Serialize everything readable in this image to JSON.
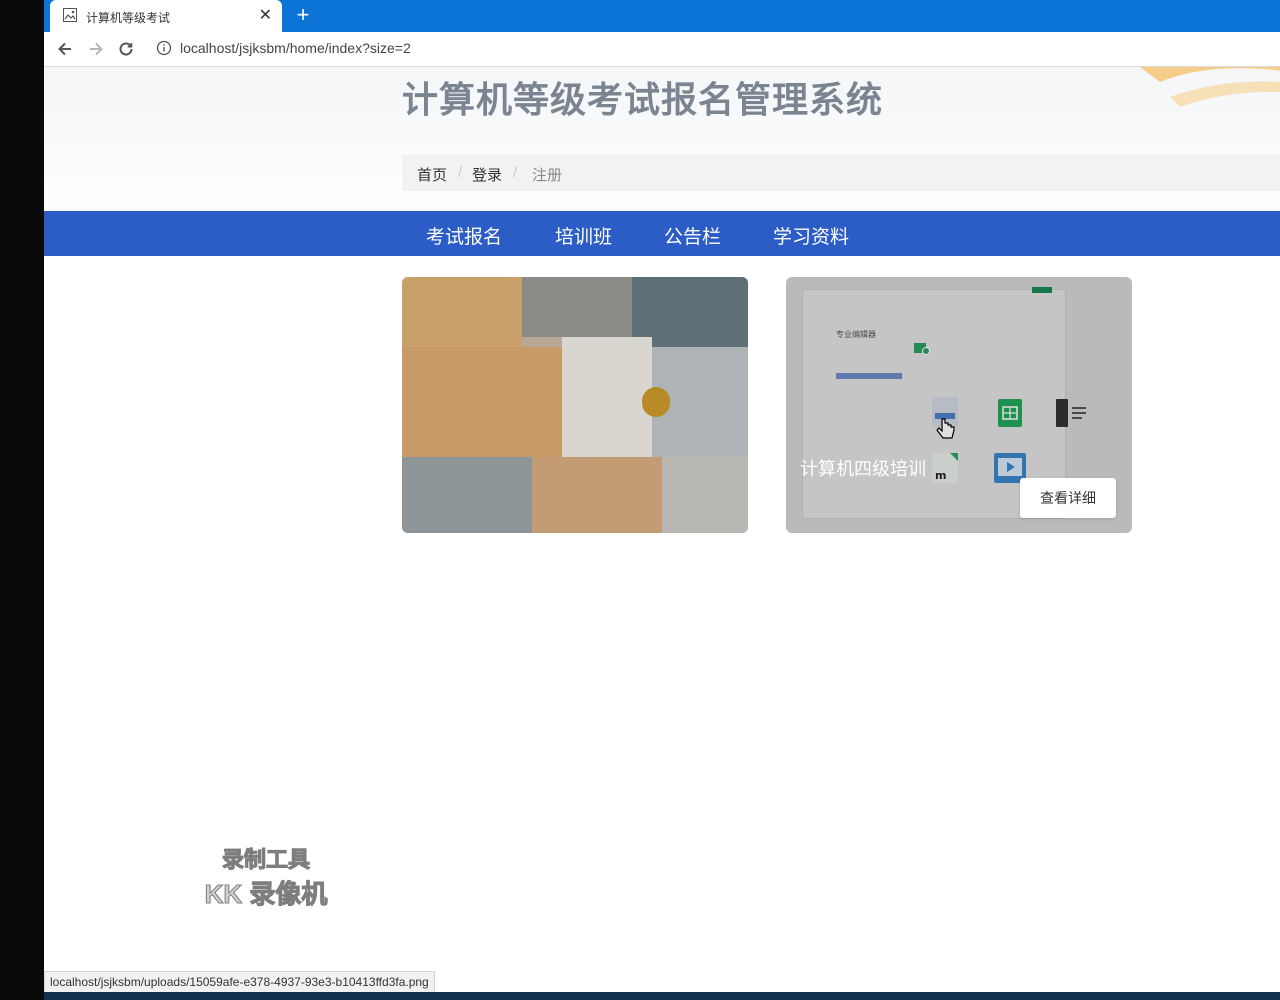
{
  "browser": {
    "tab_title": "计算机等级考试",
    "url": "localhost/jsjksbm/home/index?size=2",
    "status_url": "localhost/jsjksbm/uploads/15059afe-e378-4937-93e3-b10413ffd3fa.png"
  },
  "header": {
    "site_title": "计算机等级考试报名管理系统",
    "breadcrumb": [
      {
        "label": "首页"
      },
      {
        "label": "登录"
      },
      {
        "label": "注册"
      }
    ]
  },
  "nav": {
    "items": [
      {
        "label": "考试报名"
      },
      {
        "label": "培训班"
      },
      {
        "label": "公告栏"
      },
      {
        "label": "学习资料"
      }
    ]
  },
  "cards": [
    {
      "caption": ""
    },
    {
      "caption": "计算机四级培训",
      "button": "查看详细",
      "inner_label": "专业编辑器"
    }
  ],
  "watermark": {
    "line1": "录制工具",
    "line2": "KK 录像机"
  },
  "colors": {
    "tab_strip": "#0b74d6",
    "nav_bar": "#2c5cc5",
    "title_gray": "#7a8591"
  }
}
